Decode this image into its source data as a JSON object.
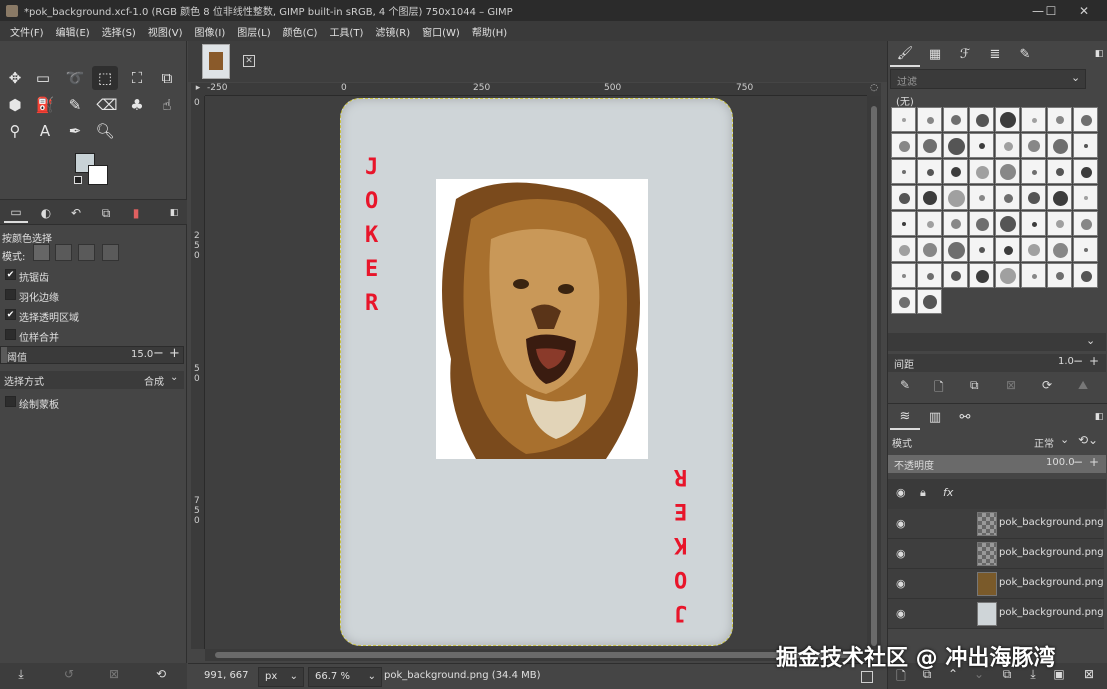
{
  "window": {
    "title": "*pok_background.xcf-1.0 (RGB 颜色 8 位非线性整数, GIMP built-in sRGB, 4 个图层) 750x1044 – GIMP",
    "minimize": "—",
    "maximize": "☐",
    "close": "✕"
  },
  "menu": [
    "文件(F)",
    "编辑(E)",
    "选择(S)",
    "视图(V)",
    "图像(I)",
    "图层(L)",
    "颜色(C)",
    "工具(T)",
    "滤镜(R)",
    "窗口(W)",
    "帮助(H)"
  ],
  "tool_options": {
    "title": "按颜色选择",
    "mode_label": "模式:",
    "antialias": "抗锯齿",
    "feather": "羽化边缘",
    "select_transparent": "选择透明区域",
    "sample_merged": "位样合并",
    "threshold_label": "阈值",
    "threshold_value": "15.0",
    "select_by_label": "选择方式",
    "select_by_value": "合成",
    "draw_mask": "绘制蒙板"
  },
  "colors": {
    "fg": "#c8d2d6",
    "bg": "#ffffff",
    "card": "#cfd5d8",
    "joker_red": "#e8152a"
  },
  "ruler": {
    "h": [
      "-250",
      "0",
      "250",
      "500",
      "750"
    ],
    "v": [
      "0",
      "2",
      "5",
      "0",
      "5",
      "0",
      "7",
      "5",
      "0"
    ]
  },
  "card": {
    "joker_left": [
      "J",
      "O",
      "K",
      "E",
      "R"
    ],
    "joker_right": [
      "R",
      "E",
      "K",
      "O",
      "J"
    ]
  },
  "status": {
    "coords": "991, 667",
    "unit": "px",
    "zoom": "66.7 %",
    "info": "pok_background.png (34.4 MB)"
  },
  "brushes": {
    "filter_placeholder": "过滤",
    "current": "(无)",
    "spacing_label": "间距",
    "spacing_value": "1.0"
  },
  "layers": {
    "mode_label": "模式",
    "mode_value": "正常",
    "opacity_label": "不透明度",
    "opacity_value": "100.0",
    "items": [
      {
        "name": "pok_background.png"
      },
      {
        "name": "pok_background.png"
      },
      {
        "name": "pok_background.png"
      },
      {
        "name": "pok_background.png"
      }
    ]
  },
  "watermark": "掘金技术社区 @ 冲出海豚湾"
}
